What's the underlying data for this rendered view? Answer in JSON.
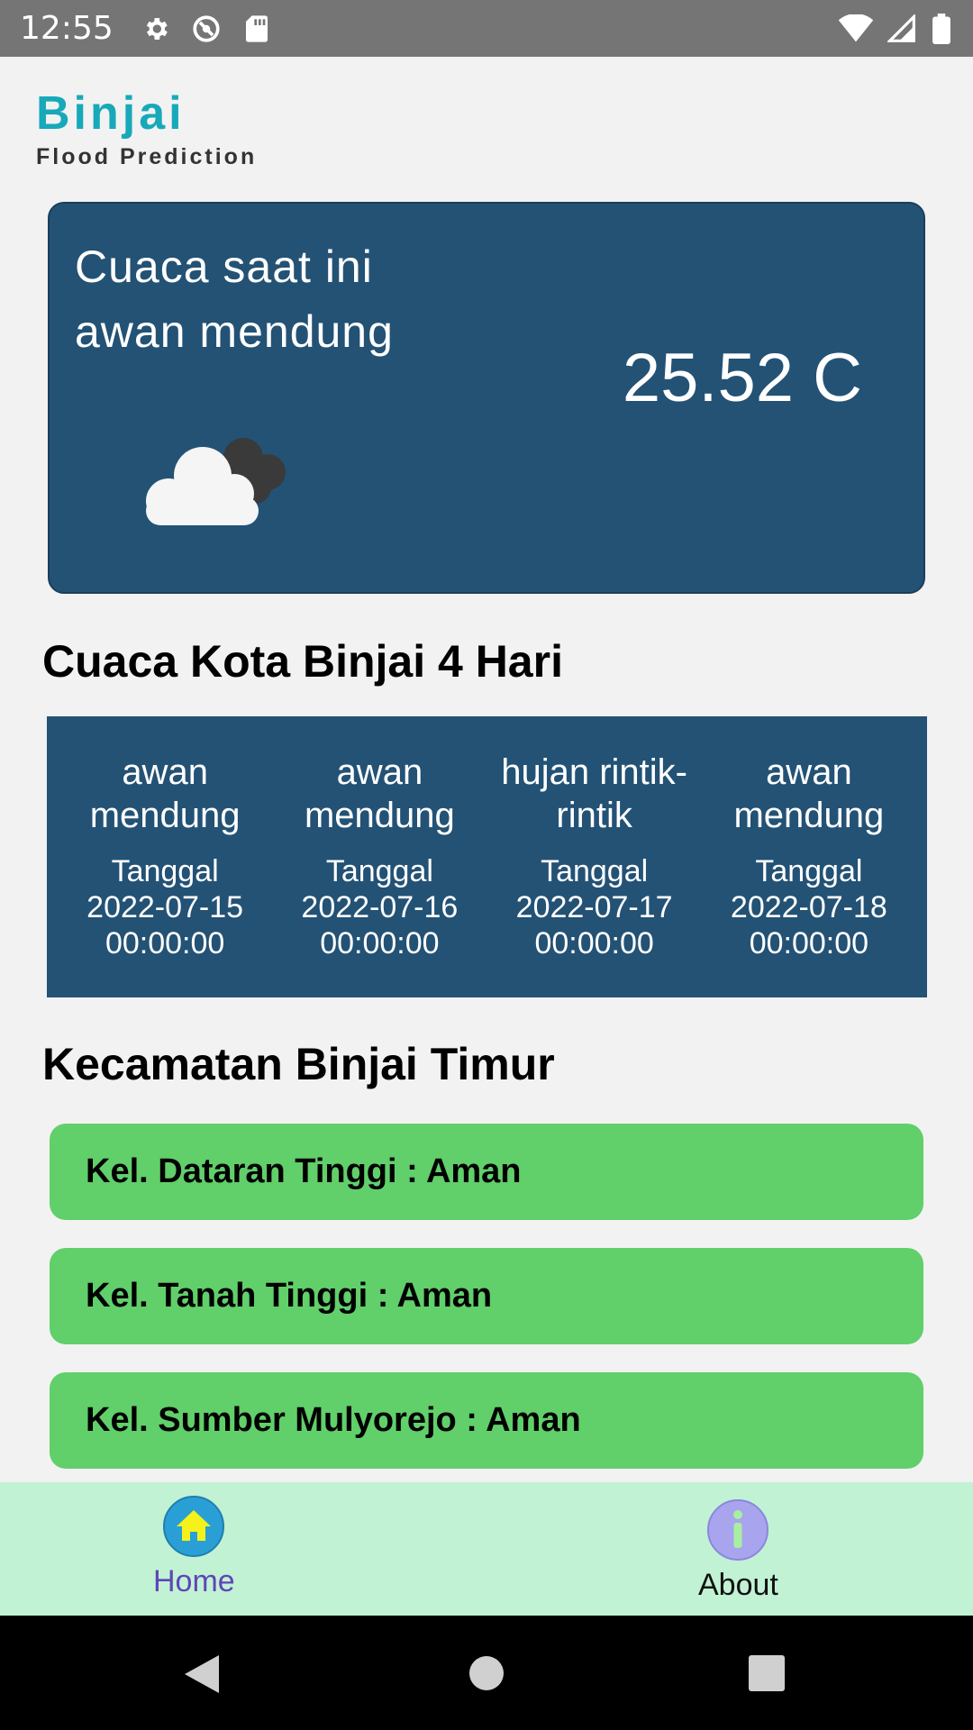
{
  "status_bar": {
    "time": "12:55",
    "icons": [
      "gear-icon",
      "no-sync-icon",
      "sd-card-icon",
      "wifi-icon",
      "signal-icon",
      "battery-icon"
    ]
  },
  "app": {
    "title": "Binjai",
    "subtitle": "Flood Prediction"
  },
  "current_weather": {
    "label": "Cuaca saat ini",
    "description": "awan mendung",
    "temperature": "25.52 C",
    "icon": "cloudy-icon"
  },
  "forecast": {
    "title": "Cuaca Kota Binjai 4 Hari",
    "days": [
      {
        "description": "awan mendung",
        "date_label": "Tanggal",
        "date": "2022-07-15",
        "time": "00:00:00"
      },
      {
        "description": "awan mendung",
        "date_label": "Tanggal",
        "date": "2022-07-16",
        "time": "00:00:00"
      },
      {
        "description": "hujan rintik-rintik",
        "date_label": "Tanggal",
        "date": "2022-07-17",
        "time": "00:00:00"
      },
      {
        "description": "awan mendung",
        "date_label": "Tanggal",
        "date": "2022-07-18",
        "time": "00:00:00"
      }
    ]
  },
  "district": {
    "title": "Kecamatan Binjai Timur",
    "items": [
      {
        "label": "Kel. Dataran Tinggi : Aman"
      },
      {
        "label": "Kel. Tanah Tinggi : Aman"
      },
      {
        "label": "Kel. Sumber Mulyorejo : Aman"
      }
    ],
    "status_color": "#61cf6a"
  },
  "bottom_nav": {
    "home_label": "Home",
    "about_label": "About",
    "active": "Home"
  },
  "colors": {
    "accent": "#17a9b9",
    "card": "#235275",
    "nav_bg": "#c1f2d4",
    "active_nav": "#6045b8"
  }
}
